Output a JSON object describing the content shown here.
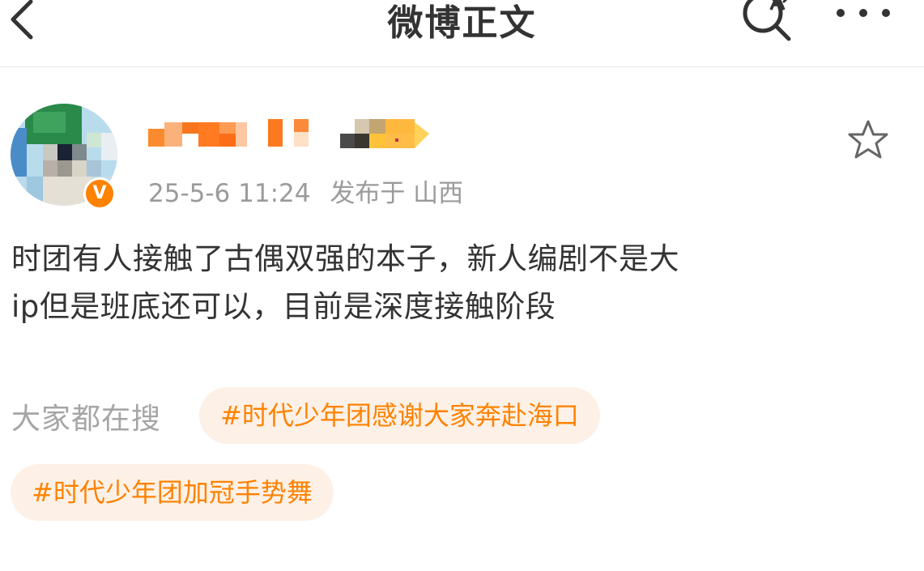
{
  "header": {
    "title": "微博正文",
    "back_icon": "chevron-left-icon",
    "search_icon": "search-icon",
    "more_icon": "more-dots-icon"
  },
  "post": {
    "author_verified_badge": "V",
    "timestamp": "25-5-6 11:24",
    "location": "发布于 山西",
    "content_lines": [
      "时团有人接触了古偶双强的本子，新人编剧不是大",
      "ip但是班底还可以，目前是深度接触阶段"
    ],
    "favorite_icon": "star-outline-icon"
  },
  "hot_search": {
    "label": "大家都在搜",
    "topics": [
      "#时代少年团感谢大家奔赴海口",
      "#时代少年团加冠手势舞"
    ]
  },
  "colors": {
    "accent": "#ff8200",
    "chip_bg": "#fdf1e7",
    "meta_text": "#9b9b9b",
    "body_text": "#333333"
  }
}
